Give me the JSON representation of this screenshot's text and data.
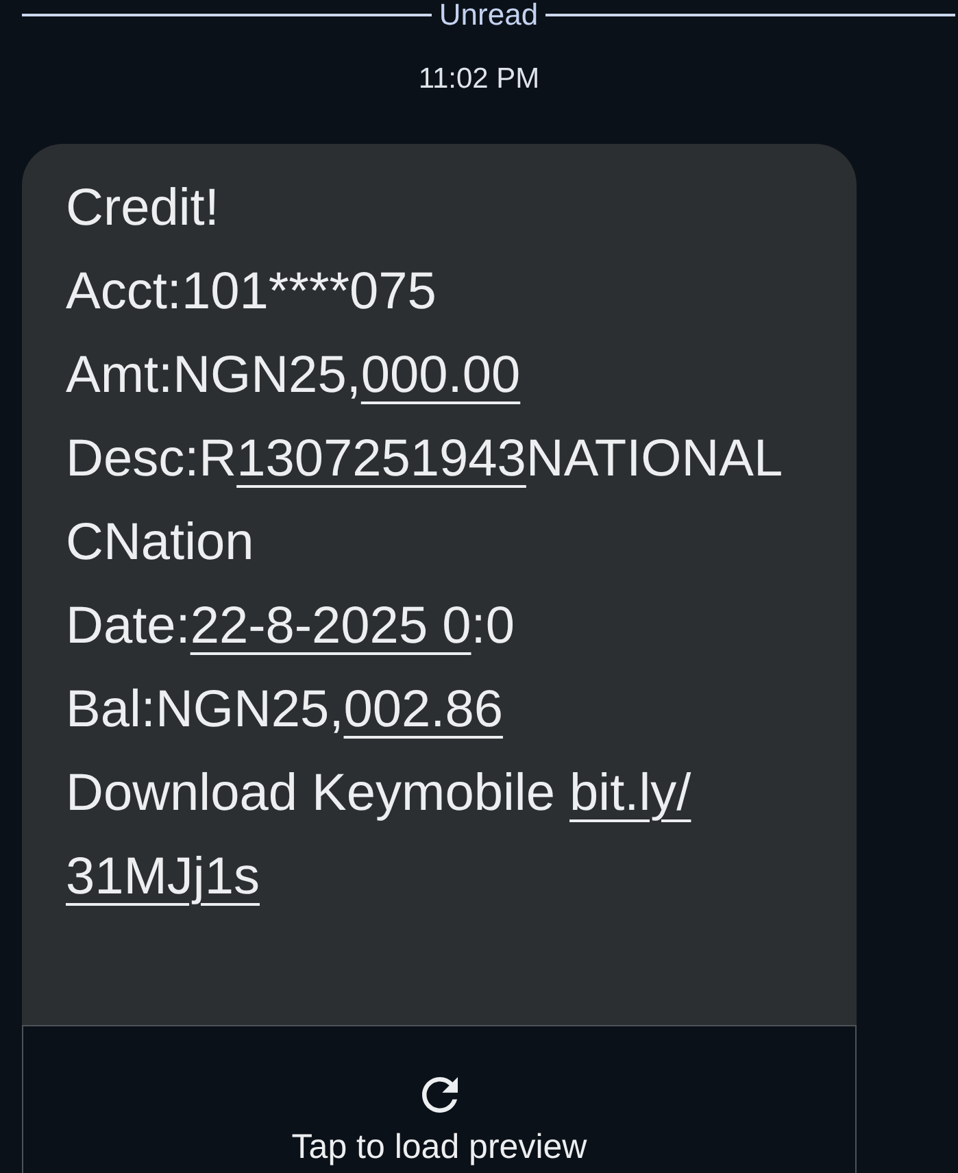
{
  "divider": {
    "label": "Unread"
  },
  "timestamp": "11:02 PM",
  "message": {
    "lines": [
      {
        "segments": [
          {
            "text": "Credit!",
            "link": false
          }
        ]
      },
      {
        "segments": [
          {
            "text": "Acct:101****075",
            "link": false
          }
        ]
      },
      {
        "segments": [
          {
            "text": "Amt:NGN25,",
            "link": false
          },
          {
            "text": "000.00",
            "link": true
          }
        ]
      },
      {
        "segments": [
          {
            "text": "Desc:R",
            "link": false
          },
          {
            "text": "1307251943",
            "link": true
          },
          {
            "text": "NATIONAL",
            "link": false
          }
        ]
      },
      {
        "segments": [
          {
            "text": "CNation",
            "link": false
          }
        ]
      },
      {
        "segments": [
          {
            "text": "Date:",
            "link": false
          },
          {
            "text": "22-8-2025 0",
            "link": true
          },
          {
            "text": ":0",
            "link": false
          }
        ]
      },
      {
        "segments": [
          {
            "text": "Bal:NGN25,",
            "link": false
          },
          {
            "text": "002.86",
            "link": true
          }
        ]
      },
      {
        "segments": [
          {
            "text": "Download Keymobile ",
            "link": false
          },
          {
            "text": "bit.ly/",
            "link": true
          }
        ]
      },
      {
        "segments": [
          {
            "text": "31MJj1s",
            "link": true
          }
        ]
      }
    ]
  },
  "link_preview": {
    "label": "Tap to load preview"
  }
}
